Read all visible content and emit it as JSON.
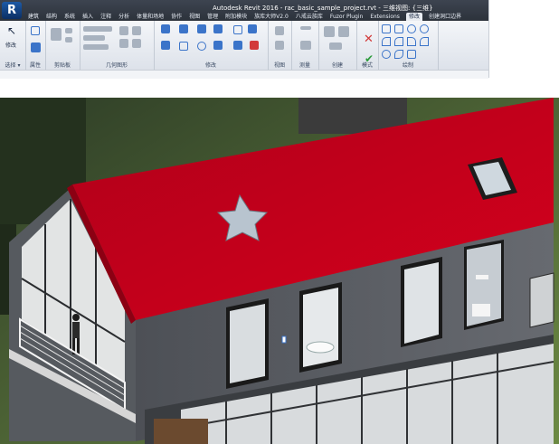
{
  "app": {
    "logo_letter": "R",
    "window_title": "Autodesk Revit 2016 -     rac_basic_sample_project.rvt - 三维视图: {三维}"
  },
  "ribbon": {
    "tabs": [
      "建筑",
      "结构",
      "系统",
      "插入",
      "注释",
      "分析",
      "体量和场地",
      "协作",
      "视图",
      "管理",
      "附加模块",
      "族库大师V2.0",
      "八戒云族库",
      "Fuzor Plugin",
      "Extensions",
      "修改",
      "创建洞口边界"
    ],
    "active_tab_index": 15,
    "panels": [
      "选择",
      "属性",
      "剪贴板",
      "几何图形",
      "修改",
      "视图",
      "测量",
      "创建",
      "模式",
      "绘制"
    ],
    "modify_label": "修改",
    "select_dropdown": "选择 ▾"
  },
  "colors": {
    "roof": "#c0001a",
    "wall": "#5a5d63",
    "ribbon_accent": "#3b74c9"
  }
}
